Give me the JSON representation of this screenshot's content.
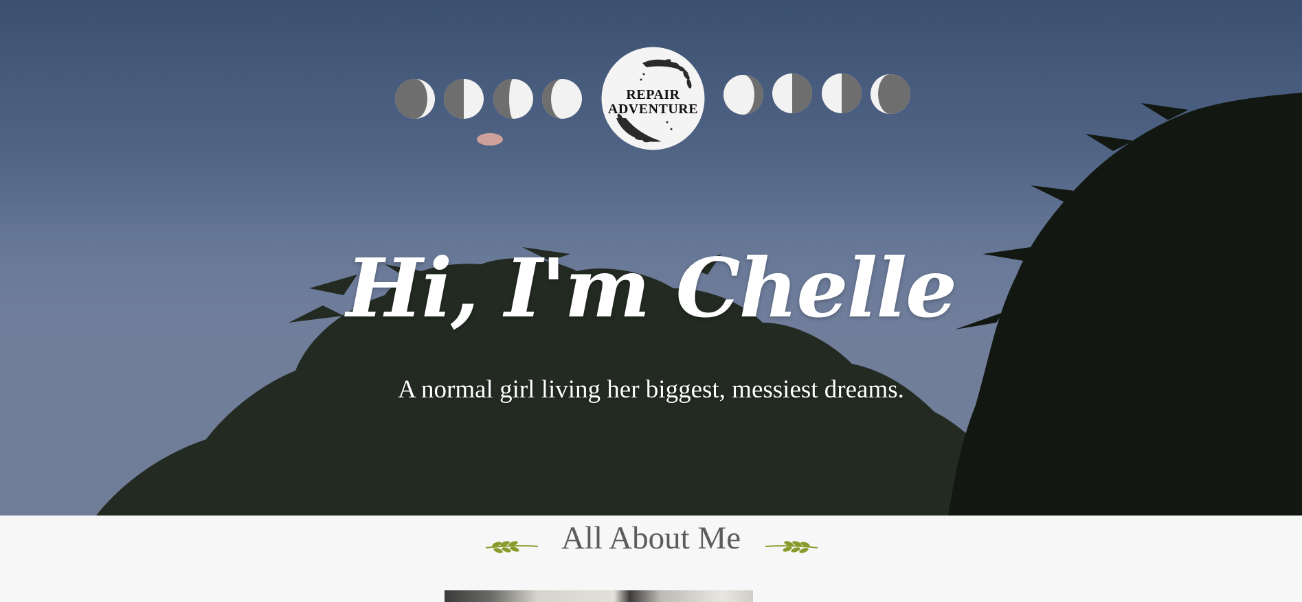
{
  "logo": {
    "line1": "REPAIR",
    "line2": "ADVENTURE"
  },
  "hero": {
    "headline": "Hi, I'm Chelle",
    "tagline": "A normal girl living her biggest, messiest dreams."
  },
  "about": {
    "title": "All About Me"
  },
  "icons": {
    "moon_phases_left": [
      "waxing-crescent-icon",
      "first-quarter-icon",
      "waxing-gibbous-icon",
      "waxing-gibbous-icon"
    ],
    "moon_phases_right": [
      "waning-gibbous-icon",
      "last-quarter-icon",
      "last-quarter-icon",
      "waning-crescent-icon"
    ],
    "sprig": "olive-branch-icon"
  },
  "colors": {
    "sky_top": "#3f5578",
    "sky_bottom": "#7884a0",
    "foliage": "#1d2418",
    "title_text": "#5c5c5c",
    "sprig_green": "#8a9a2a"
  }
}
